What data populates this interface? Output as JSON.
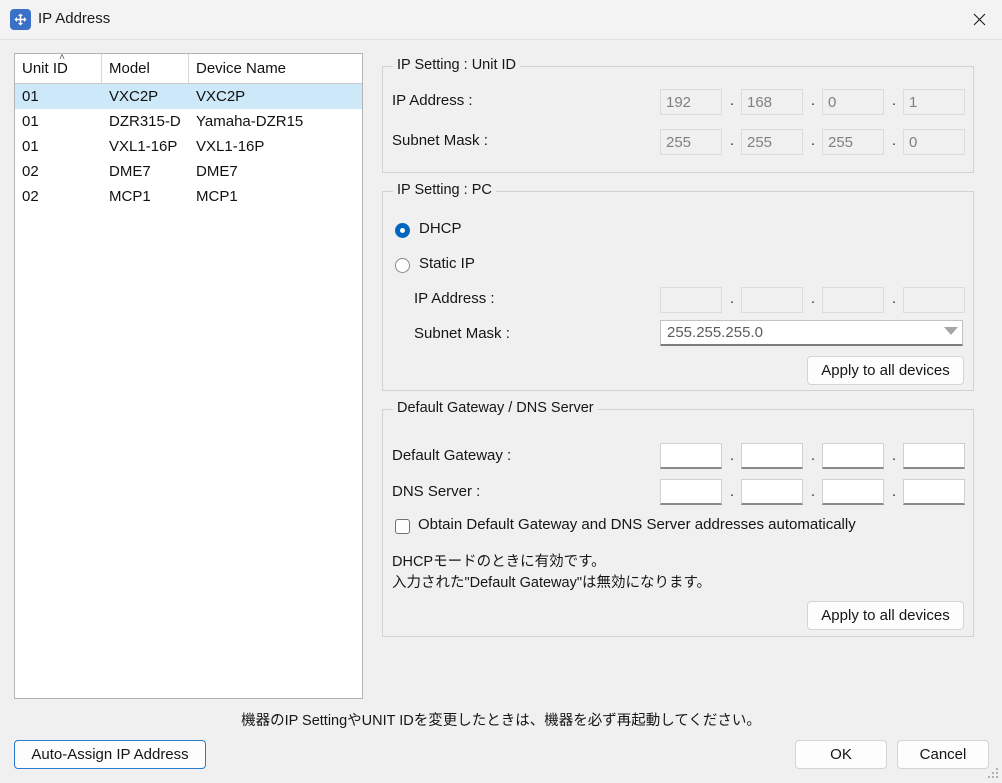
{
  "window": {
    "title": "IP Address",
    "icon": "network-move-icon",
    "close_label": "✕"
  },
  "device_list": {
    "columns": [
      "Unit ID",
      "Model",
      "Device Name"
    ],
    "sort_column": "Unit ID",
    "sort_indicator": "˄",
    "rows": [
      {
        "unit_id": "01",
        "model": "VXC2P",
        "device_name": "VXC2P",
        "selected": true
      },
      {
        "unit_id": "01",
        "model": "DZR315-D",
        "device_name": "Yamaha-DZR15",
        "selected": false
      },
      {
        "unit_id": "01",
        "model": "VXL1-16P",
        "device_name": "VXL1-16P",
        "selected": false
      },
      {
        "unit_id": "02",
        "model": "DME7",
        "device_name": "DME7",
        "selected": false
      },
      {
        "unit_id": "02",
        "model": "MCP1",
        "device_name": "MCP1",
        "selected": false
      }
    ]
  },
  "unit_id_group": {
    "legend": "IP Setting : Unit ID",
    "ip_address_label": "IP Address :",
    "ip_address": [
      "192",
      "168",
      "0",
      "1"
    ],
    "subnet_mask_label": "Subnet Mask :",
    "subnet_mask": [
      "255",
      "255",
      "255",
      "0"
    ],
    "separator": "."
  },
  "pc_group": {
    "legend": "IP Setting : PC",
    "dhcp_label": "DHCP",
    "static_label": "Static IP",
    "selected_mode": "DHCP",
    "ip_address_label": "IP Address :",
    "ip_address": [
      "",
      "",
      "",
      ""
    ],
    "subnet_mask_label": "Subnet Mask :",
    "subnet_mask_value": "255.255.255.0",
    "separator": ".",
    "apply_label": "Apply to all devices"
  },
  "gateway_group": {
    "legend": "Default Gateway / DNS Server",
    "default_gateway_label": "Default Gateway :",
    "default_gateway": [
      "",
      "",
      "",
      ""
    ],
    "dns_server_label": "DNS Server :",
    "dns_server": [
      "",
      "",
      "",
      ""
    ],
    "separator": ".",
    "checkbox_label": "Obtain Default Gateway and DNS Server addresses automatically",
    "checkbox_checked": false,
    "note_line1": "DHCPモードのときに有効です。",
    "note_line2": "入力された\"Default Gateway\"は無効になります。",
    "apply_label": "Apply to all devices"
  },
  "footer": {
    "note": "機器のIP SettingやUNIT IDを変更したときは、機器を必ず再起動してください。",
    "auto_assign_label": "Auto-Assign IP Address",
    "ok_label": "OK",
    "cancel_label": "Cancel"
  },
  "colors": {
    "accent": "#0067c0",
    "selection": "#cde8f9",
    "focus_border": "#2a7ad0",
    "title_icon": "#3a70c8",
    "window_bg": "#f0f0f0"
  }
}
